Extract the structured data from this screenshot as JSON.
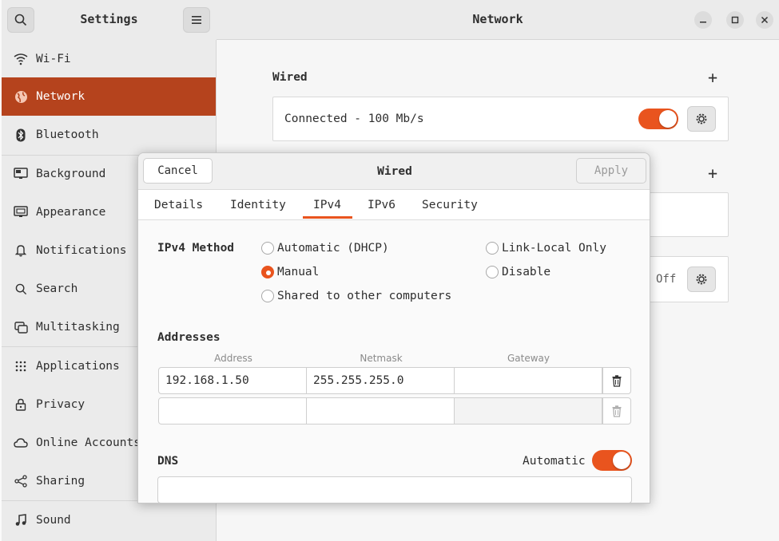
{
  "sidebar": {
    "title": "Settings",
    "items": [
      {
        "label": "Wi-Fi",
        "icon": "wifi-icon"
      },
      {
        "label": "Network",
        "icon": "globe-icon",
        "active": true
      },
      {
        "label": "Bluetooth",
        "icon": "bluetooth-icon"
      },
      {
        "label": "Background",
        "icon": "monitor-icon"
      },
      {
        "label": "Appearance",
        "icon": "appearance-icon"
      },
      {
        "label": "Notifications",
        "icon": "bell-icon"
      },
      {
        "label": "Search",
        "icon": "search-icon"
      },
      {
        "label": "Multitasking",
        "icon": "multitasking-icon"
      },
      {
        "label": "Applications",
        "icon": "grid-icon"
      },
      {
        "label": "Privacy",
        "icon": "lock-icon"
      },
      {
        "label": "Online Accounts",
        "icon": "cloud-icon"
      },
      {
        "label": "Sharing",
        "icon": "share-icon"
      },
      {
        "label": "Sound",
        "icon": "music-note-icon"
      }
    ]
  },
  "main": {
    "title": "Network",
    "wired": {
      "title": "Wired",
      "status": "Connected - 100 Mb/s",
      "enabled": true
    },
    "proxy": {
      "state": "Off"
    }
  },
  "dialog": {
    "title": "Wired",
    "cancel_label": "Cancel",
    "apply_label": "Apply",
    "tabs": [
      "Details",
      "Identity",
      "IPv4",
      "IPv6",
      "Security"
    ],
    "active_tab": "IPv4",
    "ipv4_method_label": "IPv4 Method",
    "methods": {
      "automatic": "Automatic (DHCP)",
      "link_local": "Link-Local Only",
      "manual": "Manual",
      "disable": "Disable",
      "shared": "Shared to other computers"
    },
    "selected_method": "Manual",
    "addresses_label": "Addresses",
    "columns": [
      "Address",
      "Netmask",
      "Gateway"
    ],
    "rows": [
      {
        "address": "192.168.1.50",
        "netmask": "255.255.255.0",
        "gateway": ""
      },
      {
        "address": "",
        "netmask": "",
        "gateway": ""
      }
    ],
    "dns_label": "DNS",
    "dns_automatic_label": "Automatic",
    "dns_automatic": true,
    "dns_value": ""
  },
  "colors": {
    "accent": "#e9541e",
    "sidebar_active": "#b5431d"
  }
}
